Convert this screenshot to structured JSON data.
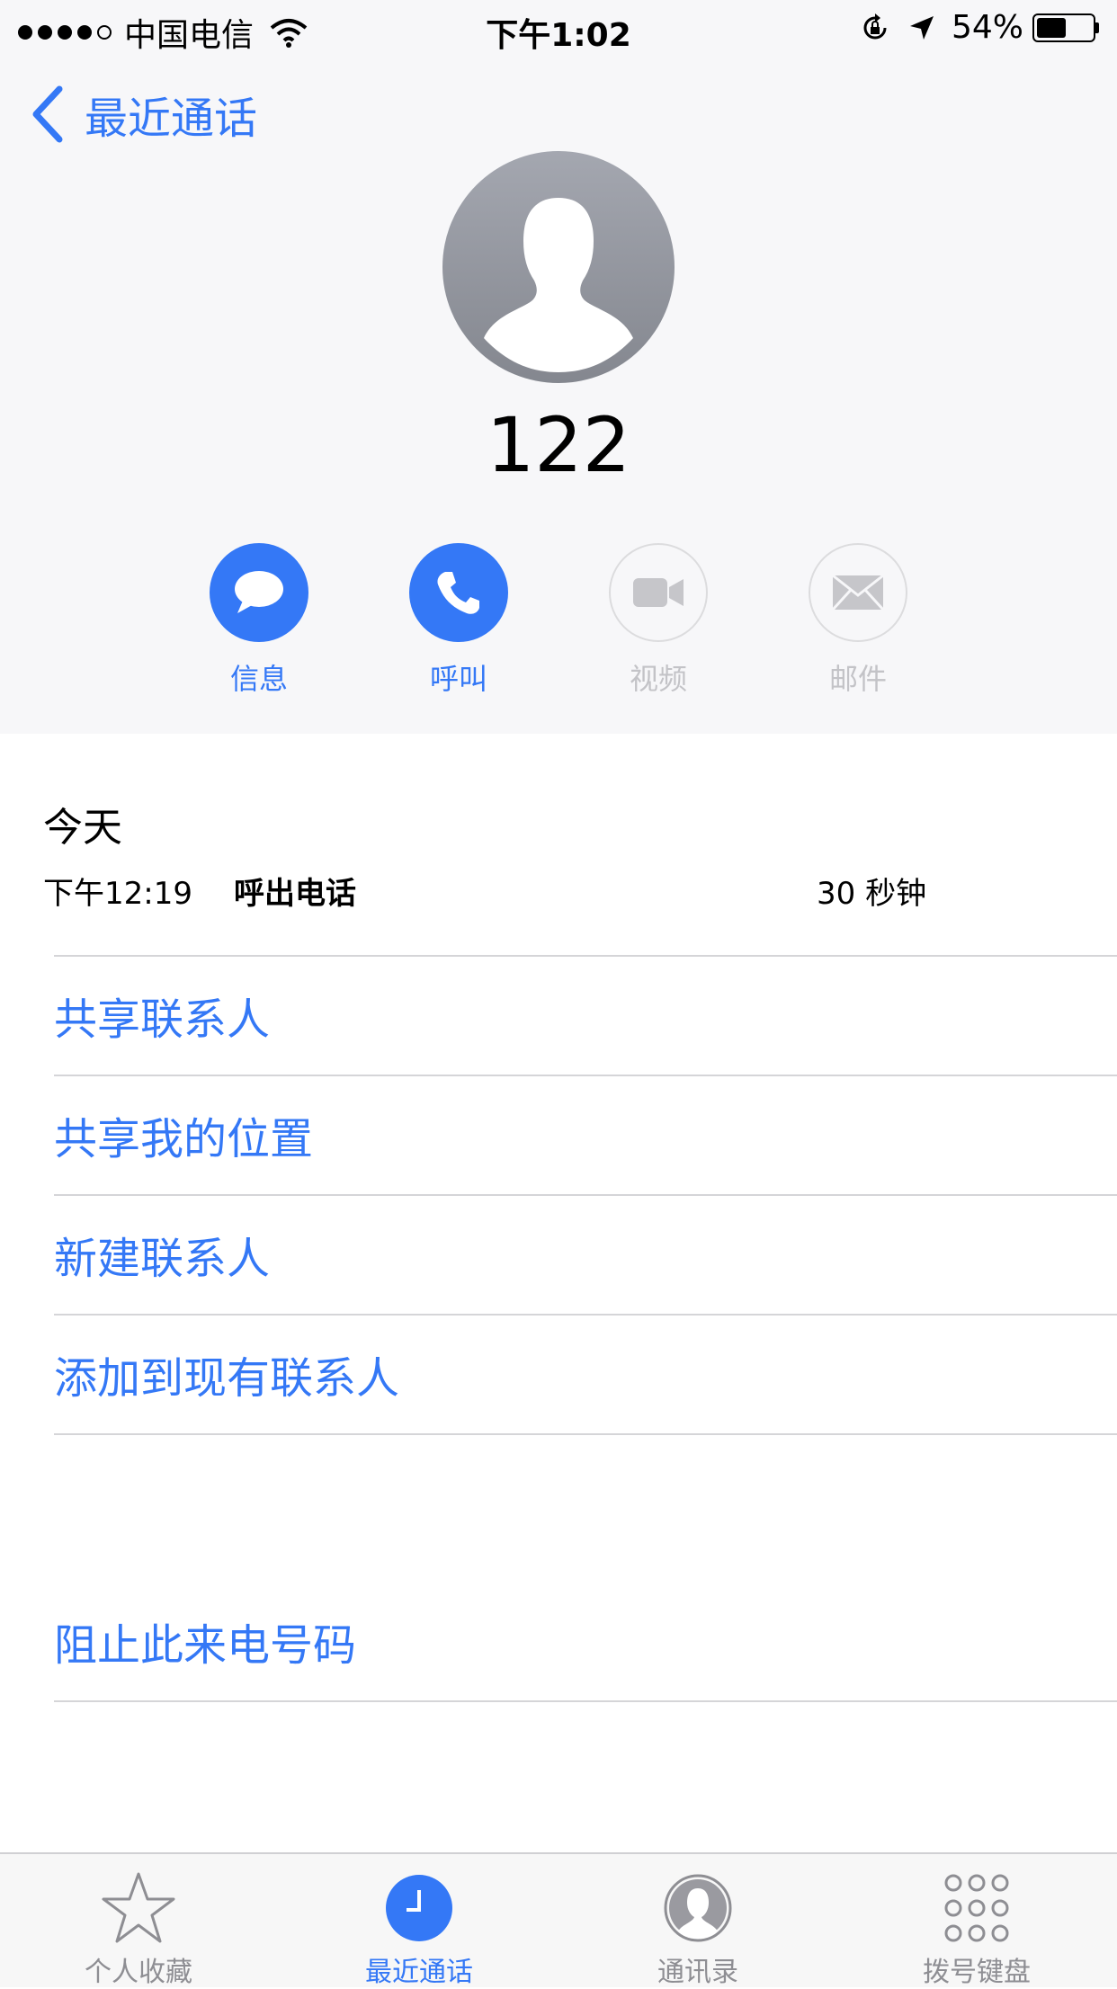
{
  "status_bar": {
    "carrier": "中国电信",
    "time": "下午1:02",
    "battery_percent": "54%",
    "battery_level": 0.54
  },
  "nav": {
    "back_label": "最近通话"
  },
  "contact": {
    "name": "122"
  },
  "actions": [
    {
      "label": "信息",
      "icon": "message-icon",
      "enabled": true
    },
    {
      "label": "呼叫",
      "icon": "phone-icon",
      "enabled": true
    },
    {
      "label": "视频",
      "icon": "video-icon",
      "enabled": false
    },
    {
      "label": "邮件",
      "icon": "mail-icon",
      "enabled": false
    }
  ],
  "history": {
    "date": "今天",
    "calls": [
      {
        "time": "下午12:19",
        "type": "呼出电话",
        "duration": "30 秒钟"
      }
    ]
  },
  "links": [
    {
      "label": "共享联系人"
    },
    {
      "label": "共享我的位置"
    },
    {
      "label": "新建联系人"
    },
    {
      "label": "添加到现有联系人"
    }
  ],
  "block": {
    "label": "阻止此来电号码"
  },
  "tabs": [
    {
      "label": "个人收藏",
      "icon": "star-icon",
      "active": false
    },
    {
      "label": "最近通话",
      "icon": "clock-icon",
      "active": true
    },
    {
      "label": "通讯录",
      "icon": "contacts-icon",
      "active": false
    },
    {
      "label": "拨号键盘",
      "icon": "keypad-icon",
      "active": false
    }
  ],
  "colors": {
    "accent": "#3478f6",
    "disabled": "#c3c3c7",
    "separator": "#d5d5d8",
    "header_bg": "#f7f7f9"
  }
}
